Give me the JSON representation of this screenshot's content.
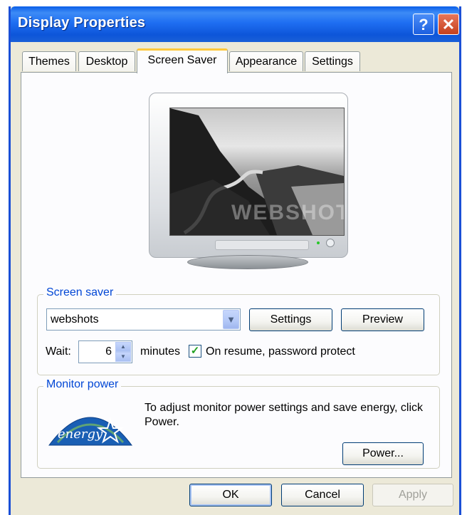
{
  "window": {
    "title": "Display Properties",
    "help_glyph": "?",
    "close_glyph": "✕"
  },
  "tabs": [
    {
      "label": "Themes",
      "active": false
    },
    {
      "label": "Desktop",
      "active": false
    },
    {
      "label": "Screen Saver",
      "active": true
    },
    {
      "label": "Appearance",
      "active": false
    },
    {
      "label": "Settings",
      "active": false
    }
  ],
  "preview": {
    "watermark": "WEBSHOTS"
  },
  "screen_saver": {
    "group_label": "Screen saver",
    "selected": "webshots",
    "settings_label": "Settings",
    "preview_label": "Preview",
    "wait_label": "Wait:",
    "wait_value": "6",
    "minutes_label": "minutes",
    "password_checked": true,
    "password_label": "On resume, password protect"
  },
  "monitor_power": {
    "group_label": "Monitor power",
    "description": "To adjust monitor power settings and save energy, click Power.",
    "power_label": "Power...",
    "logo_text": "energy"
  },
  "footer": {
    "ok_label": "OK",
    "cancel_label": "Cancel",
    "apply_label": "Apply"
  },
  "colors": {
    "titlebar": "#0a5ee8",
    "group_label": "#0046d5",
    "tab_highlight": "#ffc83c",
    "window_bg": "#ece9d8"
  }
}
